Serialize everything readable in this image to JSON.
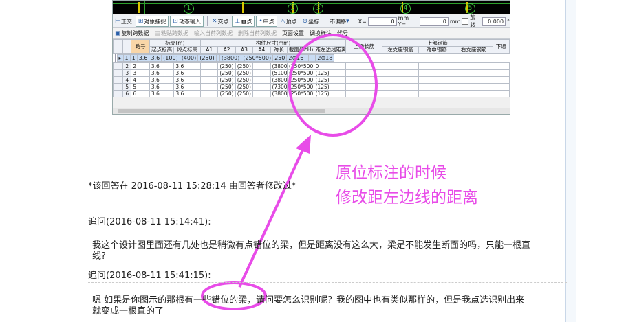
{
  "cad": {
    "axes": [
      "1",
      "2",
      "3",
      "4",
      "5"
    ]
  },
  "toolbar1": {
    "ortho": "正交",
    "snap": "对象捕捉",
    "dynamic_input": "动态输入",
    "intersection": "交点",
    "perpendicular": "垂点",
    "midpoint": "中点",
    "vertex": "顶点",
    "coordinate": "坐标",
    "offset_mode": "不偏移",
    "x_label": "X=",
    "x_value": "0",
    "y_label": "mm Y=",
    "y_value": "0",
    "mm_unit": "mm",
    "rotate_label": "旋转",
    "rotate_value": "0.000",
    "degree": "°"
  },
  "toolbar2": {
    "copy_span": "复制跨数据",
    "paste_span": "粘贴跨数据",
    "input_col": "输入当前列数据",
    "delete_col": "删除当前列数据",
    "page_setup": "页面设置",
    "swap_label": "调换标注",
    "rebar_code": "代号"
  },
  "grid": {
    "header_top": {
      "span": "跨号",
      "elevation": "标高(m)",
      "member_size": "构件尺寸(mm)",
      "top_rebar": "上部钢筋",
      "upper_long": "上通长筋"
    },
    "header_sub": [
      "起点标高",
      "终点标高",
      "A1",
      "A2",
      "A3",
      "A4",
      "跨长",
      "截面(B*H)",
      "距左边线距离",
      "左支座钢筋",
      "跨中钢筋",
      "右支座钢筋",
      "下通"
    ],
    "rows": [
      {
        "n": "1",
        "span": "1",
        "start": "3.6",
        "end": "3.6",
        "a1": "(100)",
        "a2": "(400)",
        "a3": "(250)",
        "a4": "",
        "len": "(3800)",
        "sec": "(250*500)",
        "dist": "250",
        "up": "2⊕16",
        "ls": "",
        "mid": "",
        "rs": "",
        "down": "2⊕18"
      },
      {
        "n": "2",
        "span": "2",
        "start": "3.6",
        "end": "3.6",
        "a1": "",
        "a2": "(250)",
        "a3": "(250)",
        "a4": "",
        "len": "(3800)",
        "sec": "(250*500)",
        "dist": "0",
        "up": "",
        "ls": "",
        "mid": "",
        "rs": "",
        "down": ""
      },
      {
        "n": "3",
        "span": "3",
        "start": "3.6",
        "end": "3.6",
        "a1": "",
        "a2": "(250)",
        "a3": "(250)",
        "a4": "",
        "len": "(5100)",
        "sec": "(250*500)",
        "dist": "(125)",
        "up": "",
        "ls": "",
        "mid": "",
        "rs": "",
        "down": ""
      },
      {
        "n": "4",
        "span": "4",
        "start": "3.6",
        "end": "3.6",
        "a1": "",
        "a2": "(250)",
        "a3": "(250)",
        "a4": "",
        "len": "(3800)",
        "sec": "(250*500)",
        "dist": "(125)",
        "up": "",
        "ls": "",
        "mid": "",
        "rs": "",
        "down": ""
      },
      {
        "n": "5",
        "span": "5",
        "start": "3.6",
        "end": "3.6",
        "a1": "",
        "a2": "(250)",
        "a3": "(250)",
        "a4": "",
        "len": "(7300)",
        "sec": "(250*500)",
        "dist": "(125)",
        "up": "",
        "ls": "",
        "mid": "",
        "rs": "",
        "down": ""
      },
      {
        "n": "6",
        "span": "6",
        "start": "3.6",
        "end": "3.6",
        "a1": "",
        "a2": "(250)",
        "a3": "(250)",
        "a4": "",
        "len": "(3800)",
        "sec": "(250*500)",
        "dist": "(125)",
        "up": "",
        "ls": "",
        "mid": "",
        "rs": "",
        "down": ""
      }
    ]
  },
  "annotation": {
    "line1": "原位标注的时候",
    "line2": "修改距左边线的距离",
    "color": "#e84ce8"
  },
  "posts": {
    "edited": "*该回答在 2016-08-11 15:28:14 由回答者修改过*",
    "followup1_head": "追问(2016-08-11 15:14:41):",
    "followup1_line1": "我这个设计图里面还有几处也是稍微有点错位的梁，但是距离没有这么大，梁是不能发生断面的吗，只能一根直",
    "followup1_line2": "线?",
    "followup2_head": "追问(2016-08-11 15:41:15):",
    "followup2_line1": "嗯 如果是你图示的那根有一些错位的梁，请问要怎么识别呢？我的图中也有类似那样的，但是我点选识别出来",
    "followup2_line2": "就变成一根直的了"
  }
}
